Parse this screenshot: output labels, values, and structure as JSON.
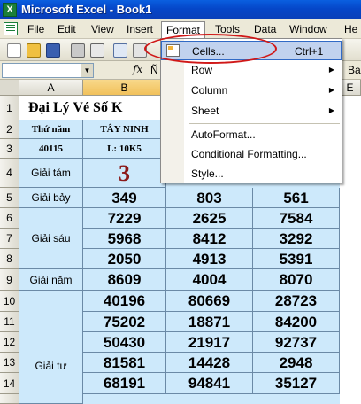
{
  "window": {
    "title": "Microsoft Excel - Book1",
    "app_icon_letter": "X"
  },
  "menubar": {
    "items": [
      "File",
      "Edit",
      "View",
      "Insert",
      "Format",
      "Tools",
      "Data",
      "Window",
      "He"
    ]
  },
  "formula": {
    "fx": "fx",
    "value": "Ñ",
    "right_value": "Ba"
  },
  "columns": [
    "A",
    "B",
    "E"
  ],
  "rows": [
    "1",
    "2",
    "3",
    "4",
    "5",
    "6",
    "7",
    "8",
    "9",
    "10",
    "11",
    "12",
    "13",
    "14"
  ],
  "sheet": {
    "title": "Đại Lý Vé Số K",
    "header_row": {
      "a": "Thứ năm",
      "b": "TÂY NINH"
    },
    "info_row": {
      "a": "40115",
      "b": "L:  10K5"
    },
    "prize_labels": {
      "tam": "Giải tám",
      "bay": "Giải bảy",
      "sau": "Giải sáu",
      "nam": "Giải năm",
      "tu": "Giải tư"
    },
    "tam_value": "3",
    "bay": [
      "349",
      "803",
      "561"
    ],
    "sau": [
      [
        "7229",
        "2625",
        "7584"
      ],
      [
        "5968",
        "8412",
        "3292"
      ],
      [
        "2050",
        "4913",
        "5391"
      ]
    ],
    "nam": [
      "8609",
      "4004",
      "8070"
    ],
    "tu": [
      [
        "40196",
        "80669",
        "28723"
      ],
      [
        "75202",
        "18871",
        "84200"
      ],
      [
        "50430",
        "21917",
        "92737"
      ],
      [
        "81581",
        "14428",
        "2948"
      ],
      [
        "68191",
        "94841",
        "35127"
      ]
    ]
  },
  "format_menu": {
    "cells": "Cells...",
    "cells_shortcut": "Ctrl+1",
    "row": "Row",
    "column": "Column",
    "sheet": "Sheet",
    "autoformat": "AutoFormat...",
    "conditional": "Conditional Formatting...",
    "style": "Style..."
  }
}
